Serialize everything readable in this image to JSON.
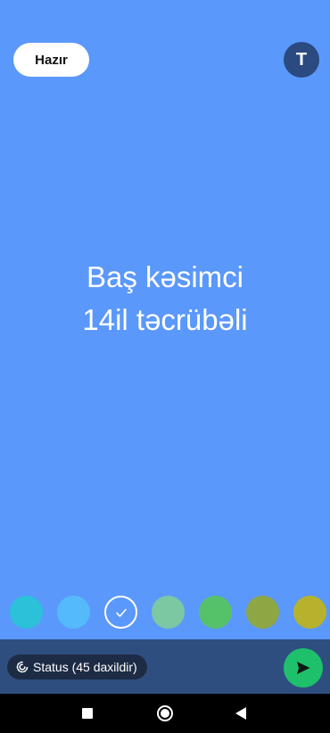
{
  "header": {
    "done_label": "Hazır",
    "text_style_label": "T"
  },
  "status_text": "Baş kəsimci\n14il təcrübəli",
  "palette": {
    "colors": [
      "#2bc1d8",
      "#54baf9",
      "#5b98fb",
      "#7bc8a3",
      "#55c26a",
      "#8ea744",
      "#b6b22d"
    ],
    "selected_index": 2
  },
  "bottom_bar": {
    "audience_label": "Status (45 daxildir)",
    "audience_icon": "status-ring-icon",
    "send_icon": "send-icon"
  },
  "navigation": {
    "icons": [
      "recents-square-icon",
      "home-circle-icon",
      "back-triangle-icon"
    ]
  },
  "colors": {
    "background": "#5b98fb",
    "bottom_bar": "#2f4e80",
    "chip": "#1d2b45",
    "send": "#1fc06b",
    "text_style_button": "#2b4a80"
  }
}
